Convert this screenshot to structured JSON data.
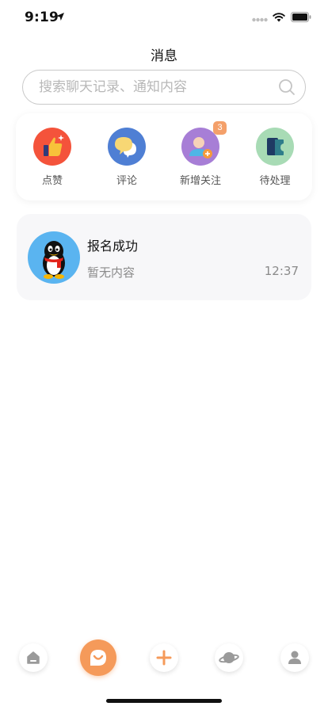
{
  "status_bar": {
    "time": "9:19",
    "icons": [
      "location-arrow-icon",
      "signal-icon",
      "wifi-icon",
      "battery-icon"
    ]
  },
  "header": {
    "title": "消息"
  },
  "search": {
    "placeholder": "搜索聊天记录、通知内容",
    "value": "",
    "icon": "search-icon"
  },
  "categories": [
    {
      "label": "点赞",
      "icon": "thumbs-up-icon",
      "color": "#f4533b"
    },
    {
      "label": "评论",
      "icon": "comment-bubbles-icon",
      "color": "#4f7fd4"
    },
    {
      "label": "新增关注",
      "icon": "new-follower-icon",
      "color": "#a77ed6",
      "badge": "3"
    },
    {
      "label": "待处理",
      "icon": "pending-card-icon",
      "color": "#a8dbb5"
    }
  ],
  "messages": [
    {
      "title": "报名成功",
      "preview": "暂无内容",
      "time": "12:37",
      "avatar": "penguin-avatar-icon",
      "avatar_color": "#5ab4f0"
    }
  ],
  "tab_bar": {
    "tabs": [
      {
        "name": "home",
        "icon": "home-icon"
      },
      {
        "name": "messages",
        "icon": "smile-chat-icon",
        "active": true
      },
      {
        "name": "add",
        "icon": "plus-icon"
      },
      {
        "name": "discover",
        "icon": "planet-icon"
      },
      {
        "name": "profile",
        "icon": "person-icon"
      }
    ],
    "accent_color": "#f59a5a"
  }
}
